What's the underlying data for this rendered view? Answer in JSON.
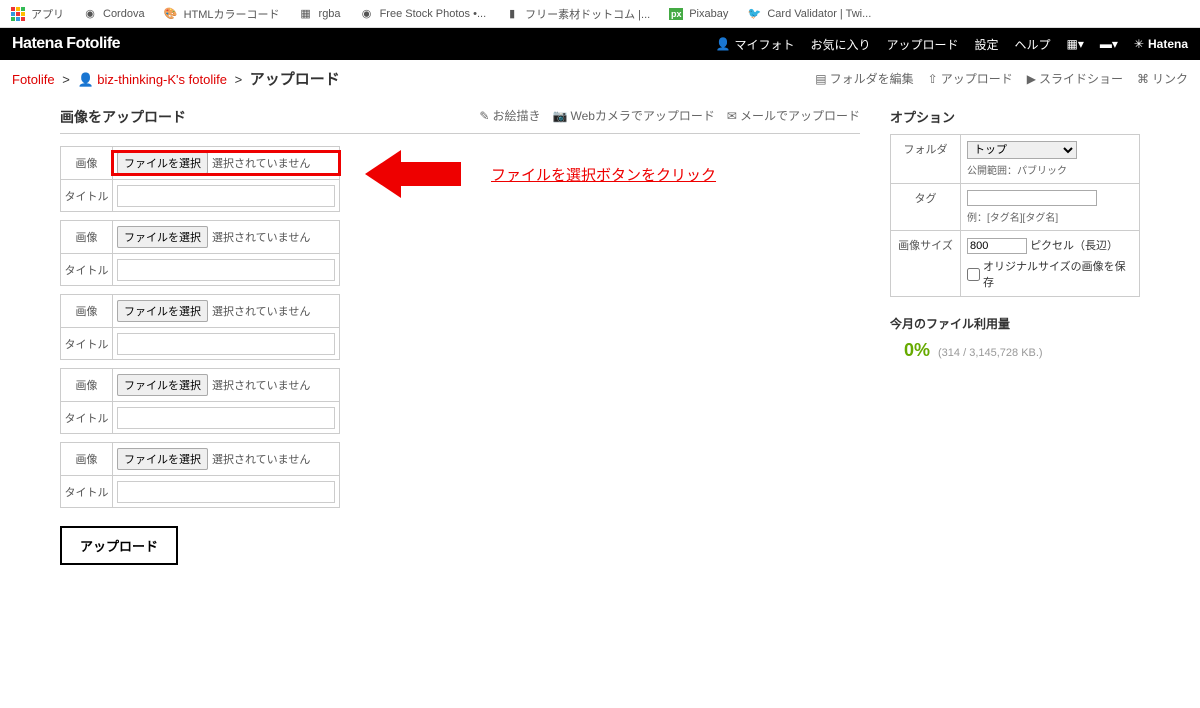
{
  "bookmarks": [
    {
      "label": "アプリ"
    },
    {
      "label": "Cordova"
    },
    {
      "label": "HTMLカラーコード"
    },
    {
      "label": "rgba"
    },
    {
      "label": "Free Stock Photos •..."
    },
    {
      "label": "フリー素材ドットコム |..."
    },
    {
      "label": "Pixabay"
    },
    {
      "label": "Card Validator | Twi..."
    }
  ],
  "header": {
    "logo": "Hatena Fotolife",
    "links": {
      "myphoto": "マイフォト",
      "favorite": "お気に入り",
      "upload": "アップロード",
      "settings": "設定",
      "help": "ヘルプ",
      "hatena": "Hatena"
    }
  },
  "breadcrumb": {
    "root": "Fotolife",
    "user": "biz-thinking-K's fotolife",
    "current": "アップロード"
  },
  "page_actions": {
    "edit_folder": "フォルダを編集",
    "upload": "アップロード",
    "slideshow": "スライドショー",
    "link": "リンク"
  },
  "main_title": "画像をアップロード",
  "alt_upload": {
    "draw": "お絵描き",
    "webcam": "Webカメラでアップロード",
    "mail": "メールでアップロード"
  },
  "upload_rows": {
    "image_label": "画像",
    "title_label": "タイトル",
    "file_button": "ファイルを選択",
    "file_status": "選択されていません"
  },
  "annotation_text": "ファイルを選択ボタンをクリック",
  "submit_label": "アップロード",
  "options": {
    "title": "オプション",
    "folder_label": "フォルダ",
    "folder_value": "トップ",
    "folder_hint": "公開範囲：パブリック",
    "tag_label": "タグ",
    "tag_hint": "例：[タグ名][タグ名]",
    "size_label": "画像サイズ",
    "size_value": "800",
    "size_unit": "ピクセル（長辺）",
    "original_cb": "オリジナルサイズの画像を保存"
  },
  "usage": {
    "title": "今月のファイル利用量",
    "percent": "0%",
    "detail": "(314 / 3,145,728 KB.)"
  }
}
